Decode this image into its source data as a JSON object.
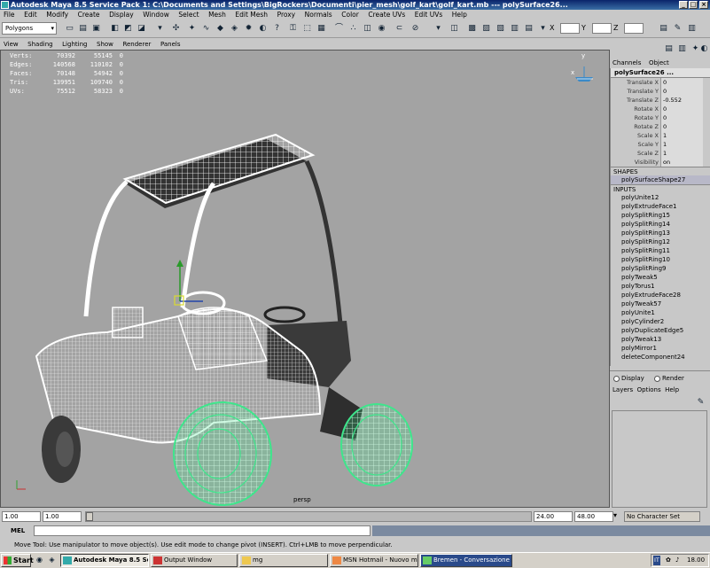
{
  "window": {
    "title": "Autodesk Maya 8.5 Service Pack 1: C:\\Documents and Settings\\BigRockers\\Documenti\\pier_mesh\\golf_kart\\golf_kart.mb   ---   polySurface26..."
  },
  "menubar": {
    "items": [
      "File",
      "Edit",
      "Modify",
      "Create",
      "Display",
      "Window",
      "Select",
      "Mesh",
      "Edit Mesh",
      "Proxy",
      "Normals",
      "Color",
      "Create UVs",
      "Edit UVs",
      "Help"
    ]
  },
  "shelf": {
    "mode": "Polygons",
    "xyz_labels": [
      "X",
      "Y",
      "Z"
    ]
  },
  "viewport": {
    "menu": [
      "View",
      "Shading",
      "Lighting",
      "Show",
      "Renderer",
      "Panels"
    ],
    "hud": [
      {
        "label": "Verts:",
        "v1": "70392",
        "v2": "55145",
        "v3": "0"
      },
      {
        "label": "Edges:",
        "v1": "140568",
        "v2": "110102",
        "v3": "0"
      },
      {
        "label": "Faces:",
        "v1": "70148",
        "v2": "54942",
        "v3": "0"
      },
      {
        "label": "Tris:",
        "v1": "139951",
        "v2": "109740",
        "v3": "0"
      },
      {
        "label": "UVs:",
        "v1": "75512",
        "v2": "58323",
        "v3": "0"
      }
    ],
    "camera_label": "persp",
    "axis_labels": [
      "x",
      "y"
    ]
  },
  "channelbox": {
    "tabs": [
      "Channels",
      "Object"
    ],
    "object_name": "polySurface26 ...",
    "attributes": [
      {
        "name": "Translate X",
        "value": "0"
      },
      {
        "name": "Translate Y",
        "value": "0"
      },
      {
        "name": "Translate Z",
        "value": "-0.552"
      },
      {
        "name": "Rotate X",
        "value": "0"
      },
      {
        "name": "Rotate Y",
        "value": "0"
      },
      {
        "name": "Rotate Z",
        "value": "0"
      },
      {
        "name": "Scale X",
        "value": "1"
      },
      {
        "name": "Scale Y",
        "value": "1"
      },
      {
        "name": "Scale Z",
        "value": "1"
      },
      {
        "name": "Visibility",
        "value": "on"
      }
    ],
    "shapes_header": "SHAPES",
    "shape": "polySurfaceShape27",
    "inputs_header": "INPUTS",
    "inputs": [
      "polyUnite12",
      "polyExtrudeFace1",
      "polySplitRing15",
      "polySplitRing14",
      "polySplitRing13",
      "polySplitRing12",
      "polySplitRing11",
      "polySplitRing10",
      "polySplitRing9",
      "polyTweak5",
      "polyTorus1",
      "polyExtrudeFace28",
      "polyTweak57",
      "polyUnite1",
      "polyCylinder2",
      "polyDuplicateEdge5",
      "polyTweak13",
      "polyMirror1",
      "deleteComponent24"
    ]
  },
  "layers": {
    "radio_display": "Display",
    "radio_render": "Render",
    "menu": [
      "Layers",
      "Options",
      "Help"
    ]
  },
  "timeline": {
    "start": "1.00",
    "current": "1.00",
    "end_range": "24.00",
    "end": "48.00",
    "character_set": "No Character Set"
  },
  "mel": {
    "label": "MEL"
  },
  "helpline": {
    "text": "Move Tool: Use manipulator to move object(s). Use edit mode to change pivot (INSERT). Ctrl+LMB to move perpendicular."
  },
  "taskbar": {
    "start": "Start",
    "buttons": [
      "Autodesk Maya 8.5 Servi...",
      "Output Window",
      "mg",
      "MSN Hotmail - Nuovo me...",
      "Bremen - Conversazione"
    ],
    "language": "IT",
    "clock": "18.00"
  },
  "colors": {
    "viewport_bg": "#a3a3a3",
    "wire_white": "#ffffff",
    "wire_green": "#3ee68c",
    "title_blue": "#0a246a"
  }
}
